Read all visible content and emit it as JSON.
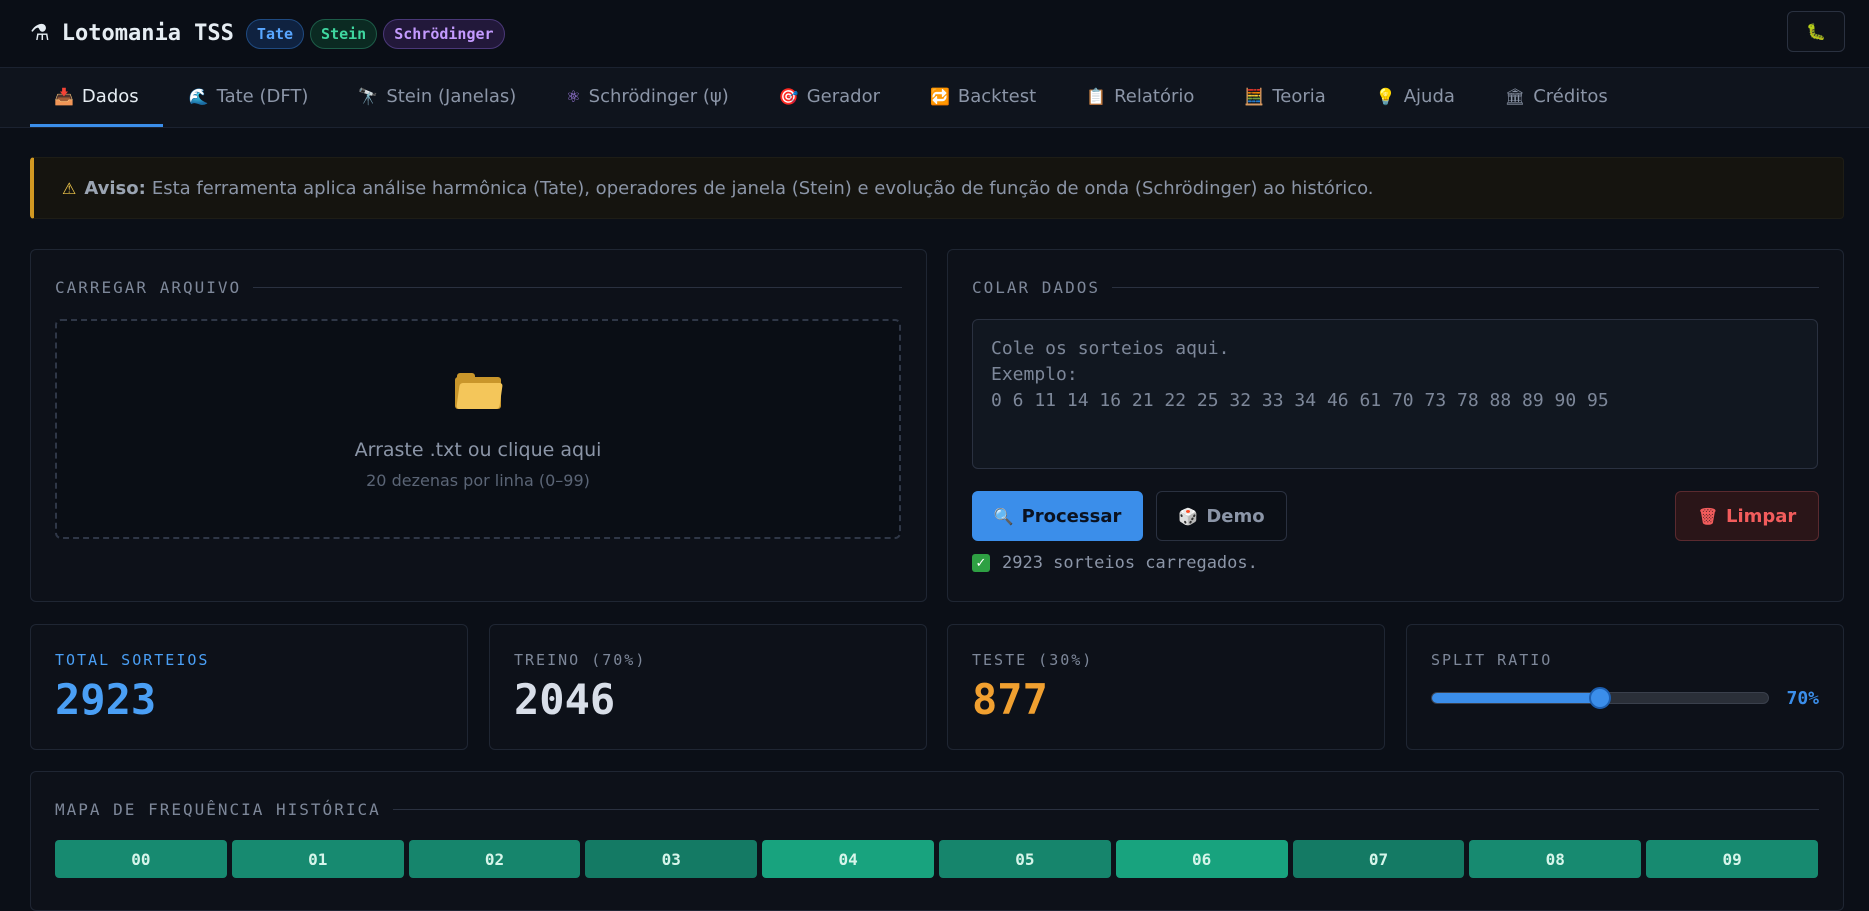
{
  "header": {
    "logo_icon": "microscope-icon",
    "title": "Lotomania TSS",
    "badges": [
      "Tate",
      "Stein",
      "Schrödinger"
    ],
    "bug_icon": "bug-icon"
  },
  "tabs": [
    {
      "icon": "📥",
      "label": "Dados",
      "active": true
    },
    {
      "icon": "🌊",
      "label": "Tate (DFT)"
    },
    {
      "icon": "🔭",
      "label": "Stein (Janelas)"
    },
    {
      "icon": "⚛",
      "label": "Schrödinger (ψ)"
    },
    {
      "icon": "🎯",
      "label": "Gerador"
    },
    {
      "icon": "🔁",
      "label": "Backtest"
    },
    {
      "icon": "📋",
      "label": "Relatório"
    },
    {
      "icon": "🧮",
      "label": "Teoria"
    },
    {
      "icon": "💡",
      "label": "Ajuda"
    },
    {
      "icon": "🏛",
      "label": "Créditos"
    }
  ],
  "alert": {
    "icon": "warning-icon",
    "label": "Aviso:",
    "text": "Esta ferramenta aplica análise harmônica (Tate), operadores de janela (Stein) e evolução de função de onda (Schrödinger) ao histórico."
  },
  "upload": {
    "title": "CARREGAR ARQUIVO",
    "icon": "folder-icon",
    "main_text": "Arraste .txt ou clique aqui",
    "sub_text": "20 dezenas por linha (0–99)"
  },
  "paste": {
    "title": "COLAR DADOS",
    "placeholder": "Cole os sorteios aqui.\nExemplo:\n0 6 11 14 16 21 22 25 32 33 34 46 61 70 73 78 88 89 90 95",
    "process_label": "Processar",
    "demo_label": "Demo",
    "clear_label": "Limpar",
    "status": "2923 sorteios carregados."
  },
  "stats": {
    "total_label": "TOTAL SORTEIOS",
    "total_value": "2923",
    "train_label": "TREINO (70%)",
    "train_value": "2046",
    "test_label": "TESTE (30%)",
    "test_value": "877",
    "split_label": "SPLIT RATIO",
    "split_value": "70%",
    "split_fraction": 0.5
  },
  "frequency": {
    "title": "MAPA DE FREQUÊNCIA HISTÓRICA",
    "cells": [
      {
        "label": "00",
        "color": "#178a70"
      },
      {
        "label": "01",
        "color": "#178a70"
      },
      {
        "label": "02",
        "color": "#16856c"
      },
      {
        "label": "03",
        "color": "#147a64"
      },
      {
        "label": "04",
        "color": "#18a37e"
      },
      {
        "label": "05",
        "color": "#16856c"
      },
      {
        "label": "06",
        "color": "#18a37e"
      },
      {
        "label": "07",
        "color": "#147a64"
      },
      {
        "label": "08",
        "color": "#178a70"
      },
      {
        "label": "09",
        "color": "#178a70"
      }
    ]
  },
  "colors": {
    "accent": "#3b8eea",
    "warning": "#d29922",
    "danger": "#f25c5c",
    "test_value": "#f0a030",
    "total_value": "#4a9ff5"
  }
}
